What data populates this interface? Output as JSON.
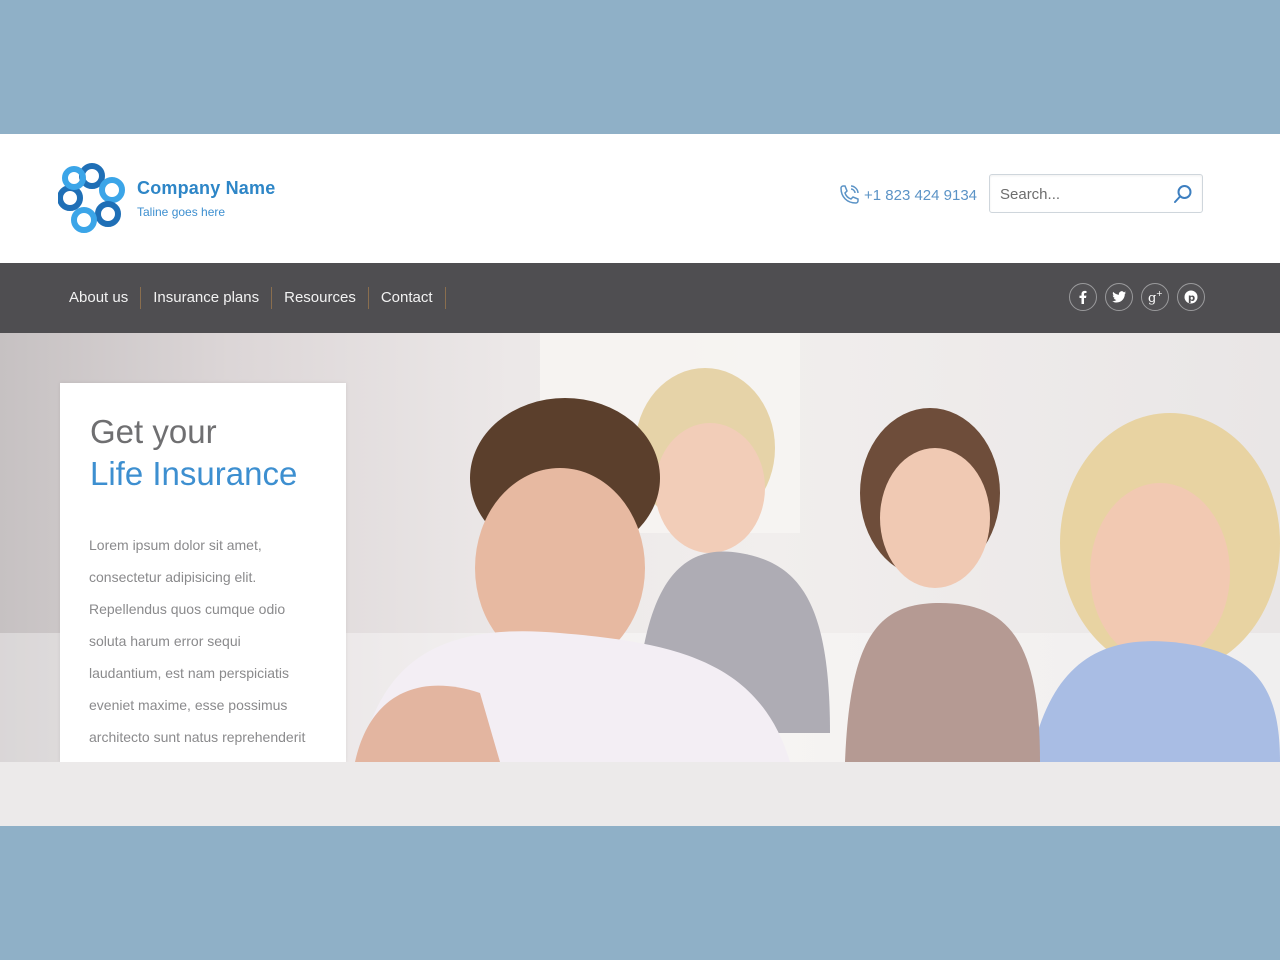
{
  "colors": {
    "frame": "#8fb0c7",
    "brand": "#2e86c7",
    "nav_bg": "#4f4e51",
    "accent_blue": "#3d8fd0"
  },
  "brand": {
    "name": "Company Name",
    "tagline": "Taline goes here"
  },
  "header": {
    "phone": "+1 823 424 9134"
  },
  "search": {
    "placeholder": "Search..."
  },
  "nav": {
    "items": [
      "About us",
      "Insurance plans",
      "Resources",
      "Contact"
    ]
  },
  "social": [
    "facebook-icon",
    "twitter-icon",
    "google-plus-icon",
    "pinterest-icon"
  ],
  "hero": {
    "title_line1": "Get your",
    "title_line2": "Life Insurance",
    "body_lines": [
      "Lorem ipsum dolor sit amet,",
      "consectetur adipisicing elit.",
      "Repellendus quos cumque odio",
      "soluta harum error sequi",
      "laudantium, est nam perspiciatis",
      "eveniet maxime, esse possimus",
      "architecto sunt natus reprehenderit"
    ]
  }
}
